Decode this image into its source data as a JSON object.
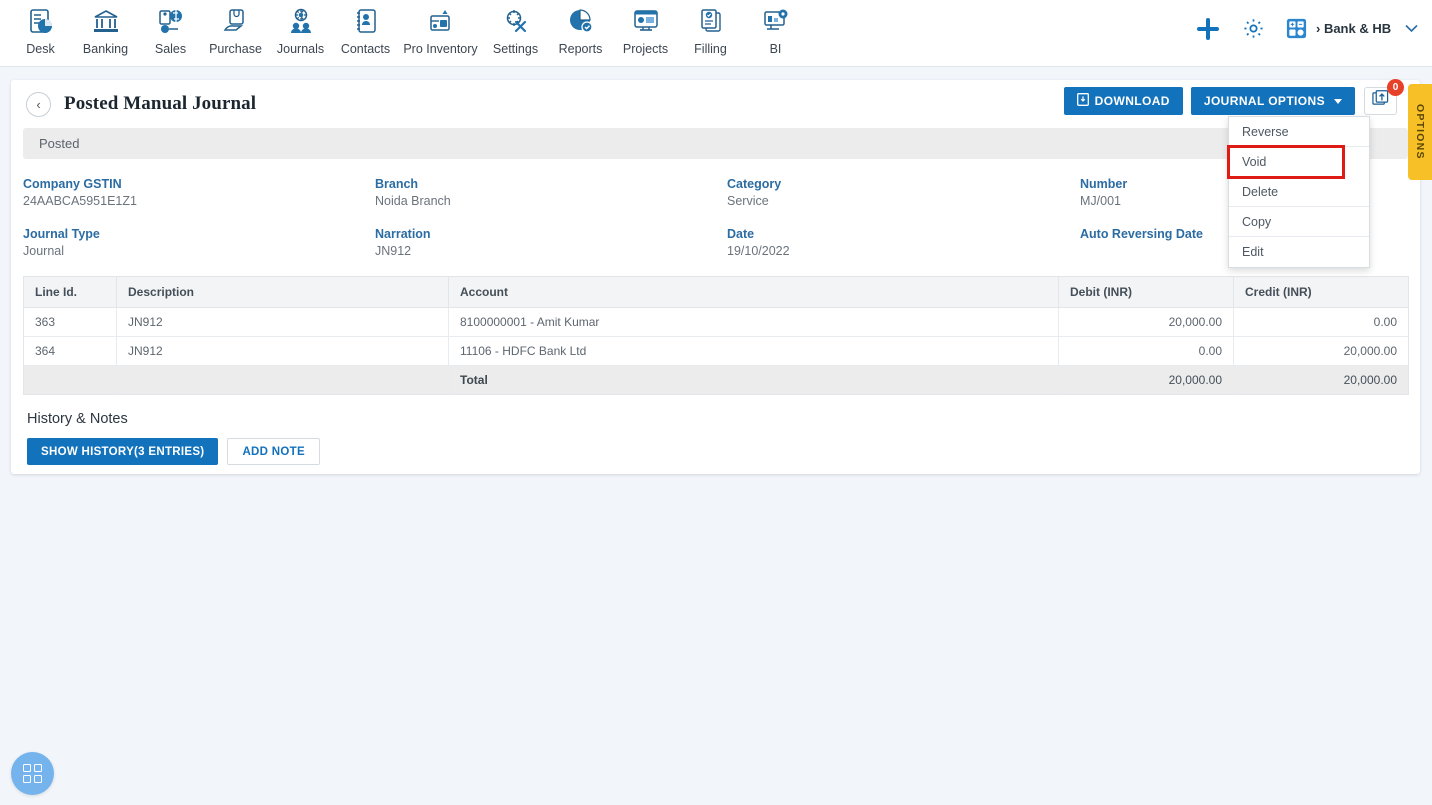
{
  "topnav": {
    "items": [
      {
        "label": "Desk",
        "icon": "desk-icon"
      },
      {
        "label": "Banking",
        "icon": "bank-icon"
      },
      {
        "label": "Sales",
        "icon": "sales-icon"
      },
      {
        "label": "Purchase",
        "icon": "purchase-icon"
      },
      {
        "label": "Journals",
        "icon": "journals-icon"
      },
      {
        "label": "Contacts",
        "icon": "contacts-icon"
      },
      {
        "label": "Pro Inventory",
        "icon": "inventory-icon"
      },
      {
        "label": "Settings",
        "icon": "settings-icon"
      },
      {
        "label": "Reports",
        "icon": "reports-icon"
      },
      {
        "label": "Projects",
        "icon": "projects-icon"
      },
      {
        "label": "Filling",
        "icon": "filling-icon"
      },
      {
        "label": "BI",
        "icon": "bi-icon"
      }
    ],
    "add_icon": "plus-icon",
    "settings_icon": "gear-icon",
    "calculator_icon": "calculator-icon",
    "account_name": "› Bank & HB I",
    "account_caret": "chevron-down-icon"
  },
  "page": {
    "back_icon": "‹",
    "title": "Posted Manual Journal",
    "status": "Posted"
  },
  "actions": {
    "download_label": "DOWNLOAD",
    "download_icon": "document-download-icon",
    "journal_options_label": "JOURNAL OPTIONS",
    "upload_icon": "upload-attachment-icon",
    "upload_badge": "0",
    "options_tab_label": "OPTIONS"
  },
  "dropdown": {
    "items": [
      {
        "label": "Reverse",
        "highlighted": false
      },
      {
        "label": "Void",
        "highlighted": true
      },
      {
        "label": "Delete",
        "highlighted": false
      },
      {
        "label": "Copy",
        "highlighted": false
      },
      {
        "label": "Edit",
        "highlighted": false
      }
    ]
  },
  "details": [
    {
      "label": "Company GSTIN",
      "value": "24AABCA5951E1Z1"
    },
    {
      "label": "Branch",
      "value": "Noida Branch"
    },
    {
      "label": "Category",
      "value": "Service"
    },
    {
      "label": "Number",
      "value": "MJ/001"
    },
    {
      "label": "Journal Type",
      "value": "Journal"
    },
    {
      "label": "Narration",
      "value": "JN912"
    },
    {
      "label": "Date",
      "value": "19/10/2022"
    },
    {
      "label": "Auto Reversing Date",
      "value": ""
    }
  ],
  "table": {
    "columns": [
      "Line Id.",
      "Description",
      "Account",
      "Debit (INR)",
      "Credit (INR)"
    ],
    "rows": [
      {
        "line_id": "363",
        "description": "JN912",
        "account": "8100000001 - Amit Kumar",
        "debit": "20,000.00",
        "credit": "0.00"
      },
      {
        "line_id": "364",
        "description": "JN912",
        "account": "11106 - HDFC Bank Ltd",
        "debit": "0.00",
        "credit": "20,000.00"
      }
    ],
    "total": {
      "line_id": "",
      "description": "",
      "label": "Total",
      "debit": "20,000.00",
      "credit": "20,000.00"
    }
  },
  "history": {
    "title": "History & Notes",
    "show_history_label": "SHOW HISTORY(3 ENTRIES)",
    "add_note_label": "ADD NOTE"
  },
  "fab": {
    "icon": "grid-apps-icon"
  },
  "colors": {
    "primary_blue": "#1272bb",
    "label_blue": "#2b6ca3",
    "highlight_red": "#e01b16",
    "badge_red": "#e8412a",
    "options_yellow": "#f6c026",
    "fab_blue": "#75b3ed",
    "page_bg": "#f2f6fb",
    "strip_gray": "#ececec"
  }
}
